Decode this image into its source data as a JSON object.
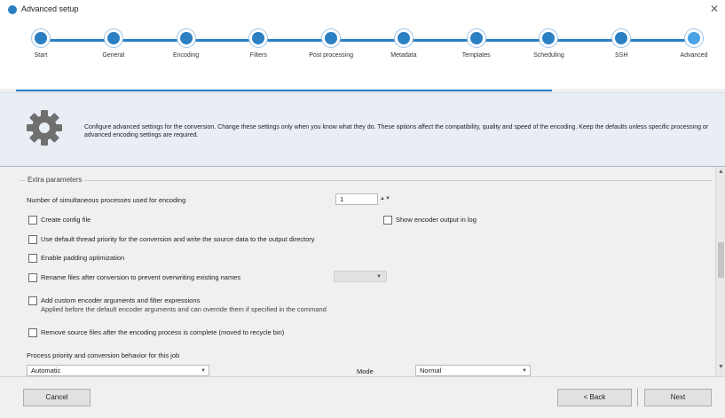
{
  "window": {
    "title": "Advanced setup",
    "close_glyph": "✕"
  },
  "wizard": {
    "steps": [
      {
        "label": "Start"
      },
      {
        "label": "General"
      },
      {
        "label": "Encoding"
      },
      {
        "label": "Filters"
      },
      {
        "label": "Post processing"
      },
      {
        "label": "Metadata"
      },
      {
        "label": "Templates"
      },
      {
        "label": "Scheduling"
      },
      {
        "label": "SSH"
      },
      {
        "label": "Advanced",
        "current": true
      }
    ]
  },
  "banner": {
    "icon": "gear-icon",
    "description": "Configure advanced settings for the conversion. Change these settings only when you know what they do. These options affect the compatibility, quality and speed of the encoding. Keep the defaults unless specific processing or advanced encoding settings are required."
  },
  "advanced": {
    "legend": "Extra parameters",
    "threads_label": "Number of simultaneous processes used for encoding",
    "threads_value": "1",
    "opt_keep_config": "Create config file",
    "opt_verbose": "Show encoder output in log",
    "opt_default_thread": "Use default thread priority for the conversion and write the source data to the output directory",
    "opt_pad": "Enable padding optimization",
    "opt_rename": "Rename files after conversion to prevent overwriting existing names",
    "opt_notes_line1": "Add custom encoder arguments and filter expressions",
    "opt_notes_line2": "Applied before the default encoder arguments and can override them if specified in the command",
    "opt_remove": "Remove source files after the encoding process is complete (moved to recycle bin)",
    "priority_label": "Process priority and conversion behavior for this job",
    "priority_value": "Automatic",
    "mode_label": "Mode",
    "mode_value": "Normal"
  },
  "footer": {
    "cancel": "Cancel",
    "back": "< Back",
    "next": "Next"
  }
}
